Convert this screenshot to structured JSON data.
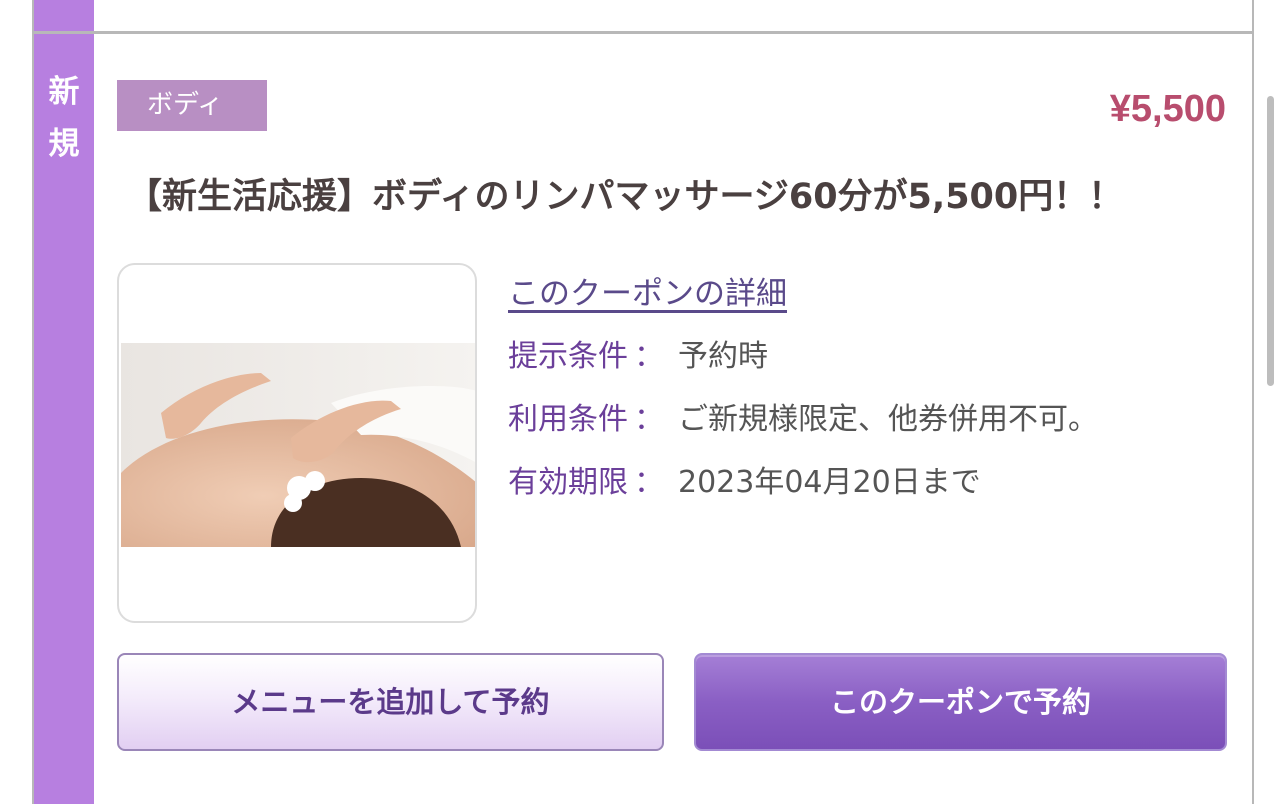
{
  "coupon": {
    "badge_chars": [
      "新",
      "規"
    ],
    "category": "ボディ",
    "price": "¥5,500",
    "title": "【新生活応援】ボディのリンパマッサージ60分が5,500円！！",
    "image_alt": "massage-photo",
    "detail_link": "このクーポンの詳細",
    "conditions": [
      {
        "key": "提示条件",
        "sep": "：",
        "value": "予約時"
      },
      {
        "key": "利用条件",
        "sep": "：",
        "value": "ご新規様限定、他券併用不可。"
      },
      {
        "key": "有効期限",
        "sep": "：",
        "value": "2023年04月20日まで"
      }
    ],
    "buttons": {
      "add_menu": "メニューを追加して予約",
      "book_coupon": "このクーポンで予約"
    }
  },
  "colors": {
    "accent_purple": "#b77fe0",
    "price_red": "#b84d6e",
    "tag_bg": "#b88fc3"
  }
}
